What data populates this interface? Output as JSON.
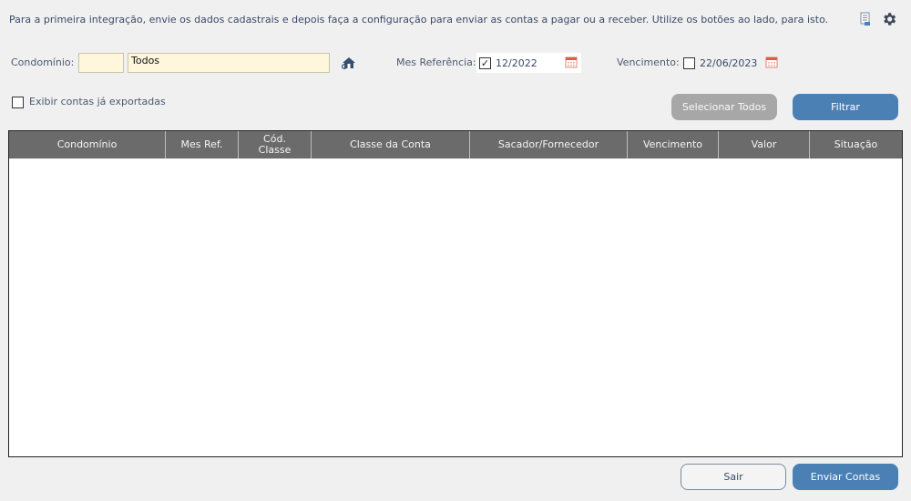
{
  "header": {
    "info_text": "Para a primeira integração, envie os dados cadastrais e depois faça a configuração para enviar as contas a pagar ou a receber. Utilize os botões ao lado, para isto.",
    "icons": [
      "document-list-icon",
      "gear-icon"
    ]
  },
  "filters": {
    "condominio_label": "Condomínio:",
    "condominio_code": "",
    "condominio_name": "Todos",
    "mes_referencia_label": "Mes Referência:",
    "mes_referencia_checked": true,
    "mes_referencia_value": "12/2022",
    "vencimento_label": "Vencimento:",
    "vencimento_checked": false,
    "vencimento_value": "22/06/2023",
    "exibir_exportadas_label": "Exibir contas já exportadas",
    "exibir_exportadas_checked": false
  },
  "buttons": {
    "selecionar_todos": "Selecionar Todos",
    "filtrar": "Filtrar",
    "sair": "Sair",
    "enviar_contas": "Enviar Contas"
  },
  "table": {
    "columns": [
      "Condomínio",
      "Mes Ref.",
      "Cód.\nClasse",
      "Classe da Conta",
      "Sacador/Fornecedor",
      "Vencimento",
      "Valor",
      "Situação"
    ],
    "rows": []
  },
  "colors": {
    "accent": "#4a80b4",
    "header_bg": "#6b6b6b",
    "field_bg": "#fff7dc"
  }
}
